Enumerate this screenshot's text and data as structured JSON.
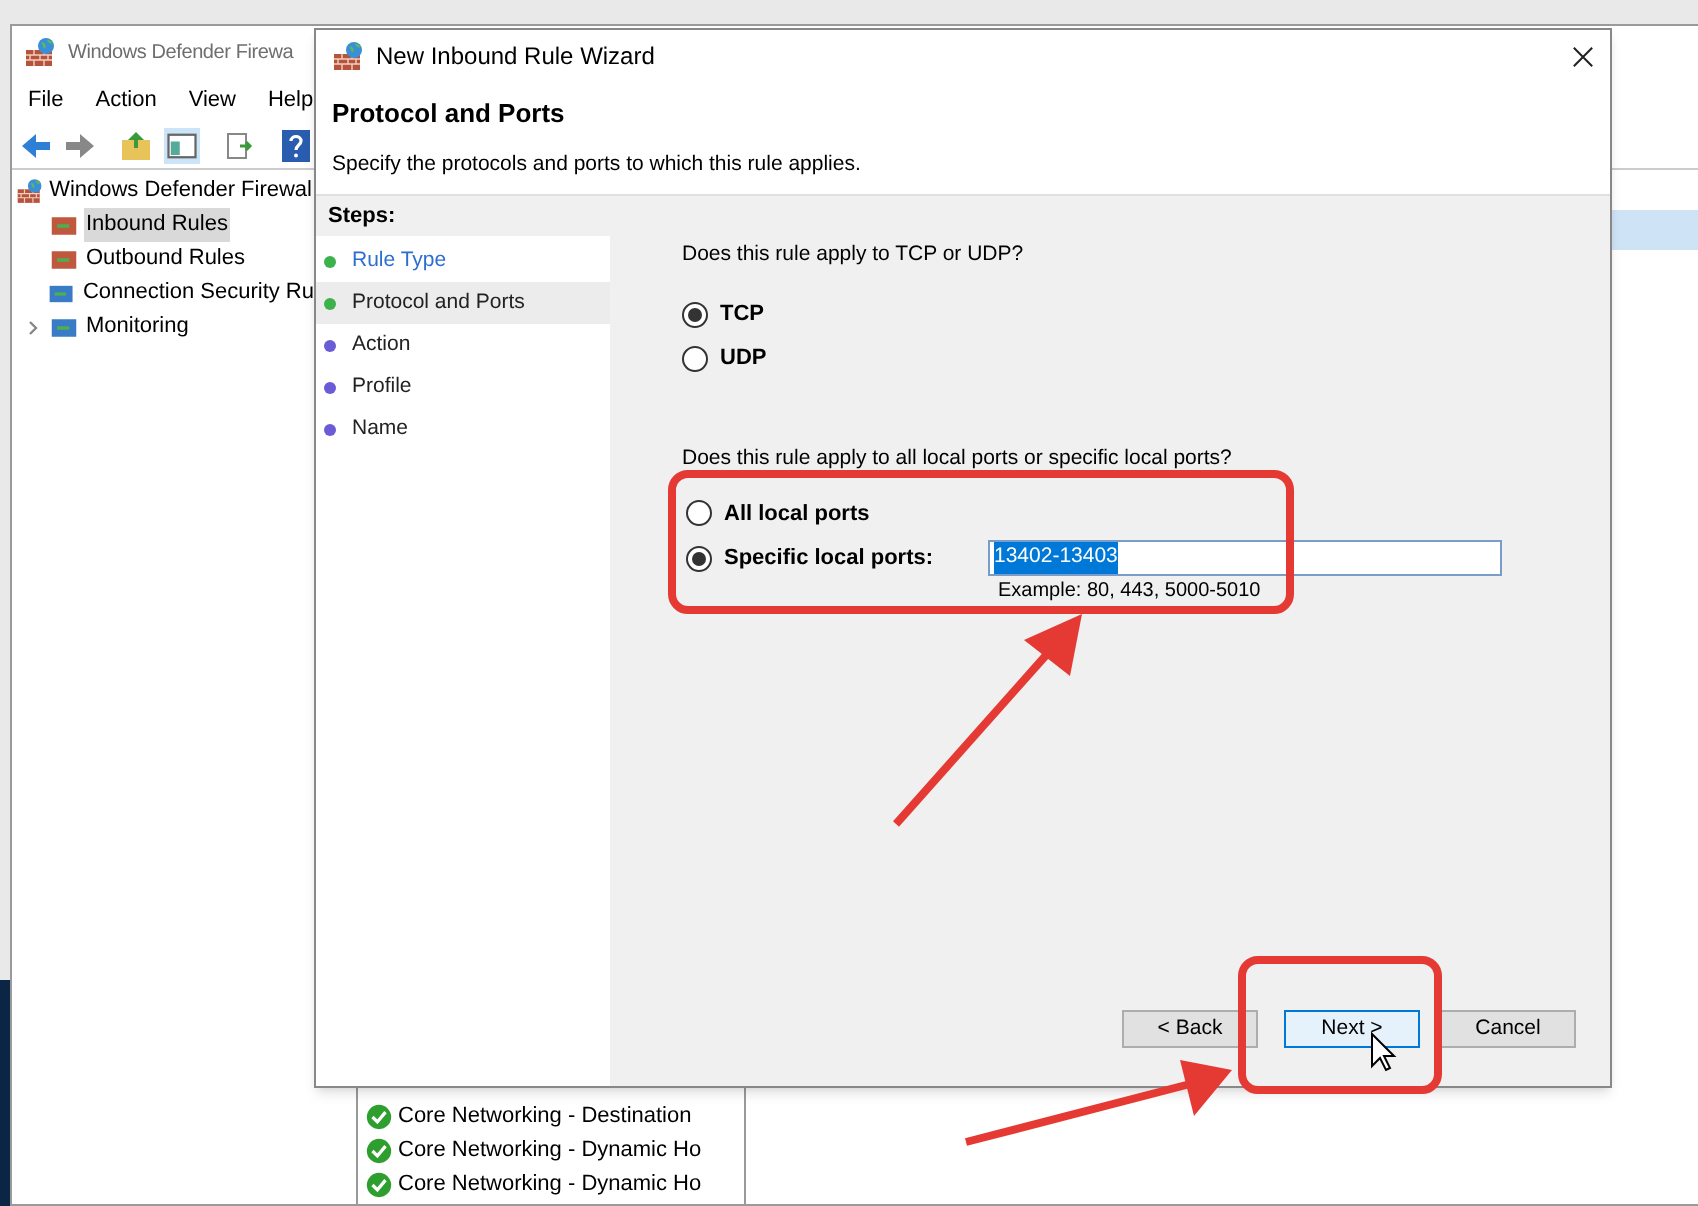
{
  "background_window": {
    "title": "Windows Defender Firewa",
    "menu": [
      "File",
      "Action",
      "View",
      "Help"
    ],
    "tree": {
      "label": "Windows Defender Firewal",
      "children": [
        {
          "label": "Inbound Rules",
          "selected": true
        },
        {
          "label": "Outbound Rules",
          "selected": false
        },
        {
          "label": "Connection Security Ru",
          "selected": false
        },
        {
          "label": "Monitoring",
          "selected": false
        }
      ]
    },
    "rules": [
      "Core Networking - Destination",
      "Core Networking - Dynamic Ho",
      "Core Networking - Dynamic Ho"
    ]
  },
  "dialog": {
    "title": "New Inbound Rule Wizard",
    "heading": "Protocol and Ports",
    "subheading": "Specify the protocols and ports to which this rule applies.",
    "steps_label": "Steps:",
    "steps": [
      {
        "label": "Rule Type",
        "selected": false,
        "done": true
      },
      {
        "label": "Protocol and Ports",
        "selected": true,
        "done": true
      },
      {
        "label": "Action",
        "selected": false,
        "done": false
      },
      {
        "label": "Profile",
        "selected": false,
        "done": false
      },
      {
        "label": "Name",
        "selected": false,
        "done": false
      }
    ],
    "protocol_question": "Does this rule apply to TCP or UDP?",
    "protocol_options": [
      {
        "label": "TCP",
        "selected": true
      },
      {
        "label": "UDP",
        "selected": false
      }
    ],
    "ports_question": "Does this rule apply to all local ports or specific local ports?",
    "port_options": [
      {
        "label": "All local ports",
        "selected": false
      },
      {
        "label": "Specific local ports:",
        "selected": true
      }
    ],
    "ports_value": "13402-13403",
    "ports_example": "Example: 80, 443, 5000-5010",
    "buttons": [
      {
        "label": "< Back",
        "focused": false
      },
      {
        "label": "Next >",
        "focused": true
      },
      {
        "label": "Cancel",
        "focused": false
      }
    ]
  }
}
